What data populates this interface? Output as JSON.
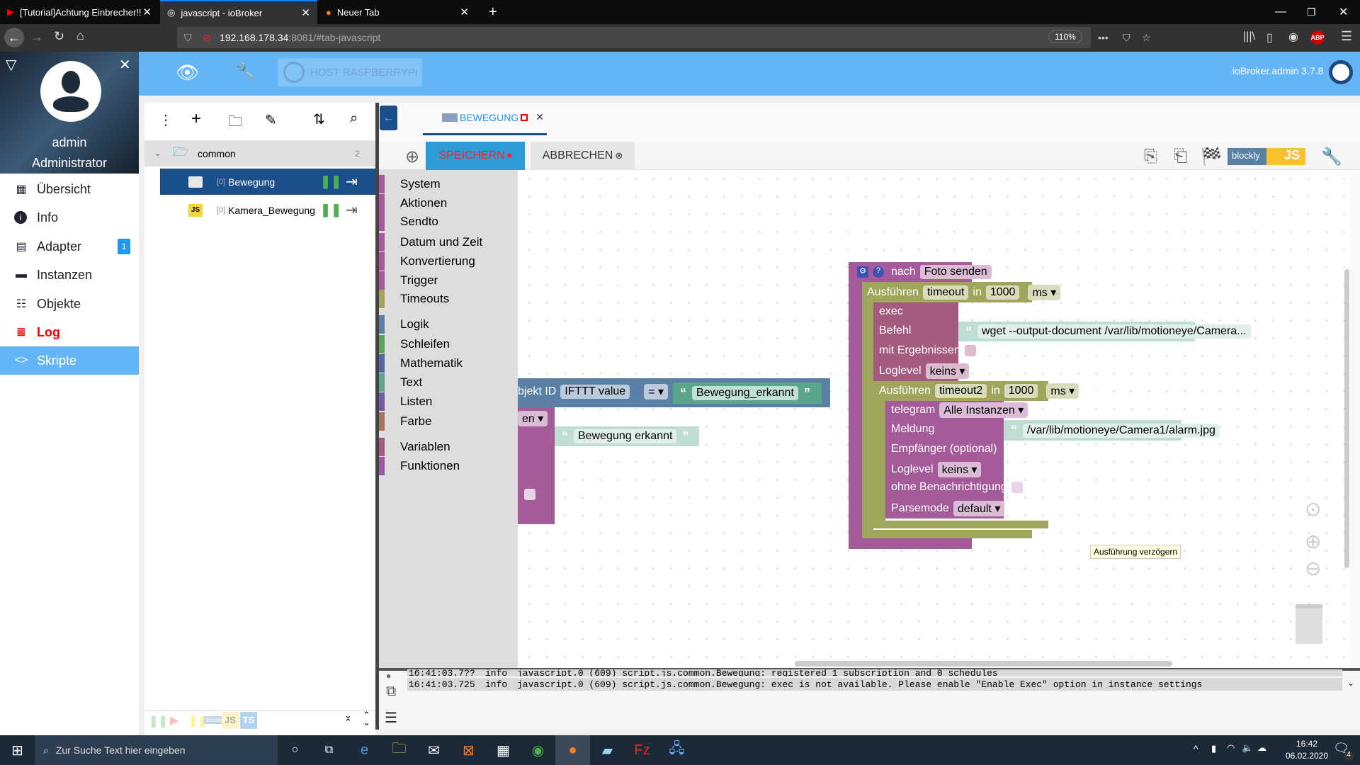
{
  "browser": {
    "tabs": [
      {
        "title": "[Tutorial]Achtung Einbrecher!!",
        "active": false
      },
      {
        "title": "javascript - ioBroker",
        "active": true
      },
      {
        "title": "Neuer Tab",
        "active": false
      }
    ],
    "url_host": "192.168.178.34",
    "url_rest": ":8081/#tab-javascript",
    "zoom": "110%",
    "abp": "ABP"
  },
  "app": {
    "host_label": "HOST RASPBERRYPI",
    "version": "ioBroker.admin 3.7.8",
    "accent": "#64b5f6"
  },
  "user": {
    "name": "admin",
    "role": "Administrator"
  },
  "sidebar": {
    "items": [
      {
        "label": "Übersicht",
        "icon": "grid-icon"
      },
      {
        "label": "Info",
        "icon": "info-icon"
      },
      {
        "label": "Adapter",
        "icon": "store-icon",
        "badge": "1"
      },
      {
        "label": "Instanzen",
        "icon": "instances-icon"
      },
      {
        "label": "Objekte",
        "icon": "list-icon"
      },
      {
        "label": "Log",
        "icon": "log-icon"
      },
      {
        "label": "Skripte",
        "icon": "code-icon",
        "active": true
      }
    ]
  },
  "scripts": {
    "folder": {
      "name": "common",
      "count": "2"
    },
    "items": [
      {
        "prefix": "[0]",
        "name": "Bewegung",
        "type": "blockly",
        "selected": true
      },
      {
        "prefix": "[0]",
        "name": "Kamera_Bewegung",
        "type": "JS"
      }
    ],
    "footer": {
      "js": "JS",
      "ts": "TS",
      "blockly": "blockly"
    }
  },
  "editor": {
    "tab_label": "BEWEGUNG",
    "save": "SPEICHERN",
    "cancel": "ABBRECHEN",
    "blockly_js_left": "blockly",
    "blockly_js_right": "JS",
    "toolbox": [
      "System",
      "Aktionen",
      "Sendto",
      "Datum und Zeit",
      "Konvertierung",
      "Trigger",
      "Timeouts",
      "Logik",
      "Schleifen",
      "Mathematik",
      "Text",
      "Listen",
      "Farbe",
      "Variablen",
      "Funktionen"
    ],
    "toolbox_colors": [
      "#a55b99",
      "#a55b99",
      "#a55b99",
      "#a55b99",
      "#a55b99",
      "#a55b99",
      "#9fa55b",
      "#5b80a5",
      "#5ba55b",
      "#5b67a5",
      "#5ba58c",
      "#745ba5",
      "#a5745b",
      "#a55b80",
      "#995ba5"
    ]
  },
  "blocks": {
    "trigger": {
      "objekt_id": "bjekt ID",
      "id_value": "IFTTT value",
      "op": "=",
      "string": "Bewegung_erkannt",
      "dropdown": "en",
      "msg": "Bewegung erkannt"
    },
    "proc": {
      "nach": "nach",
      "name": "Foto senden"
    },
    "timeout1": {
      "label": "Ausführen",
      "name": "timeout",
      "in": "in",
      "value": "1000",
      "unit": "ms",
      "unit2": "ms"
    },
    "exec": {
      "title": "exec",
      "befehl": "Befehl",
      "cmd": "wget --output-document /var/lib/motioneye/Camera...",
      "mit": "mit Ergebnissen",
      "loglevel": "Loglevel",
      "loglevel_val": "keins"
    },
    "timeout2": {
      "label": "Ausführen",
      "name": "timeout2",
      "in": "in",
      "value": "1000",
      "unit": "ms",
      "unit2": "ms"
    },
    "telegram": {
      "title": "telegram",
      "instance": "Alle Instanzen",
      "meldung": "Meldung",
      "meldung_val": "/var/lib/motioneye/Camera1/alarm.jpg",
      "empf": "Empfänger (optional)",
      "loglevel": "Loglevel",
      "loglevel_val": "keins",
      "ohne": "ohne Benachrichtigung",
      "parsemode": "Parsemode",
      "parsemode_val": "default"
    },
    "tooltip": "Ausführung verzögern"
  },
  "log": [
    {
      "time": "16:41:03.7??",
      "level": "info",
      "msg": "javascript.0 (609) script.js.common.Bewegung: registered 1 subscription and 0 schedules"
    },
    {
      "time": "16:41:03.725",
      "level": "info",
      "msg": "javascript.0 (609) script.js.common.Bewegung: exec is not available. Please enable \"Enable Exec\" option in instance settings"
    }
  ],
  "taskbar": {
    "search": "Zur Suche Text hier eingeben",
    "time": "16:42",
    "date": "06.02.2020",
    "notifications": "4"
  }
}
